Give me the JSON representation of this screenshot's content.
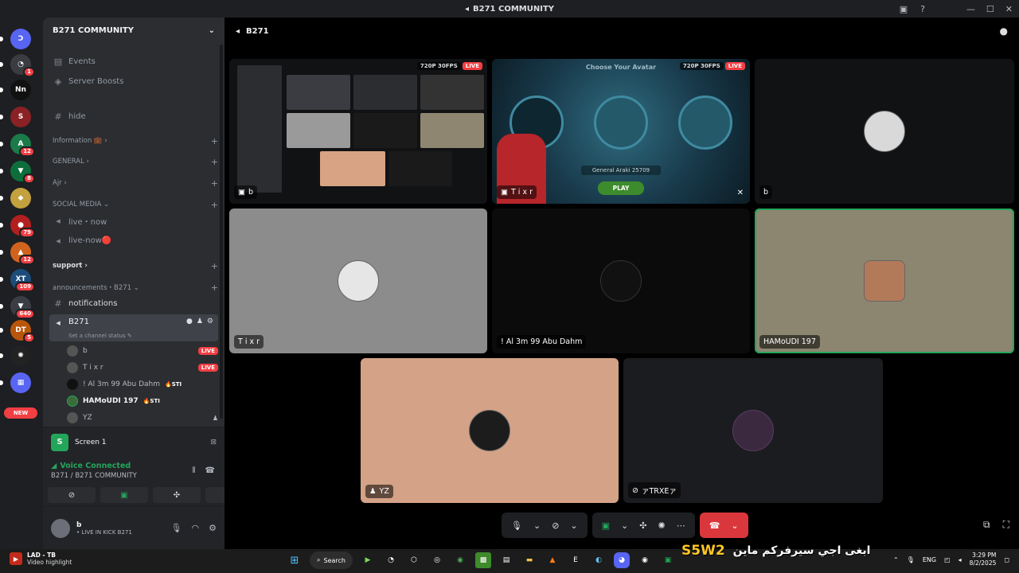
{
  "window": {
    "title": "B271 COMMUNITY"
  },
  "rail": {
    "servers": [
      {
        "label": "Ↄ",
        "badge": "",
        "color": "#5865f2"
      },
      {
        "label": "◔",
        "badge": "1",
        "color": "#3a3c42"
      },
      {
        "label": "Nn",
        "badge": "",
        "color": "#111"
      },
      {
        "label": "S",
        "badge": "",
        "color": "#8a2124"
      },
      {
        "label": "A",
        "badge": "12",
        "color": "#1b7a4a"
      },
      {
        "label": "▼",
        "badge": "8",
        "color": "#0d6e3b"
      },
      {
        "label": "◆",
        "badge": "",
        "color": "#c2a13e"
      },
      {
        "label": "●",
        "badge": "79",
        "color": "#b31f1f"
      },
      {
        "label": "▲",
        "badge": "12",
        "color": "#d0631d"
      },
      {
        "label": "XT",
        "badge": "109",
        "color": "#1c4c7a"
      },
      {
        "label": "▼",
        "badge": "640",
        "color": "#3b3d45"
      },
      {
        "label": "DT",
        "badge": "5",
        "color": "#b8560b"
      },
      {
        "label": "✺",
        "badge": "",
        "color": "#222"
      },
      {
        "label": "▦",
        "badge": "",
        "color": "#5865f2"
      }
    ],
    "new_label": "NEW"
  },
  "sidebar": {
    "server_name": "B271 COMMUNITY",
    "events": "Events",
    "boosts": "Server Boosts",
    "hide": "hide",
    "categories": {
      "information": "Information 💼",
      "general": "GENERAL",
      "ajr": "Ajr",
      "social": "SOCIAL MEDIA",
      "support": "support",
      "announcements": "announcements・B271"
    },
    "live_now_1": "live・now",
    "live_now_2": "live-now🔴",
    "notifications": "notifications",
    "active_channel": "B271",
    "channel_status": "Set a channel status ✎",
    "voice_users": [
      {
        "name": "b",
        "tag": "",
        "live": "LIVE"
      },
      {
        "name": "T i x r",
        "tag": "",
        "live": "LIVE"
      },
      {
        "name": "! Al 3m 99 Abu Dahm",
        "tag": "🔥STI",
        "live": ""
      },
      {
        "name": "HAMoUDI 197",
        "tag": "🔥STI",
        "live": ""
      },
      {
        "name": "YZ",
        "tag": "",
        "live": ""
      }
    ]
  },
  "screen_panel": {
    "label": "Screen 1",
    "icon": "S"
  },
  "voice_panel": {
    "title": "Voice Connected",
    "subtitle": "B271 / B271 COMMUNITY"
  },
  "user_panel": {
    "name": "b",
    "status": "• LIVE IN KICK B271"
  },
  "stage": {
    "channel": "B271",
    "tiles": [
      {
        "name": "b",
        "quality": "720P 30FPS",
        "live": "LIVE"
      },
      {
        "name": "T i x r",
        "quality": "720P 30FPS",
        "live": "LIVE"
      },
      {
        "name": "b"
      },
      {
        "name": "T i x r"
      },
      {
        "name": "! Al 3m 99 Abu Dahm"
      },
      {
        "name": "HAMoUDI 197"
      },
      {
        "name": "YZ"
      },
      {
        "name": "ァTRXEァ"
      }
    ],
    "game": {
      "title": "Choose Your Avatar",
      "player": "General Araki 25709",
      "play": "PLAY"
    }
  },
  "taskbar": {
    "notif_title": "LAD - TB",
    "notif_sub": "Video highlight",
    "search": "Search",
    "overlay_brand": "S5W2",
    "overlay_arabic": "ابغى اجي سيرفركم ماين",
    "lang": "ENG",
    "time": "3:29 PM",
    "date": "8/2/2025"
  }
}
